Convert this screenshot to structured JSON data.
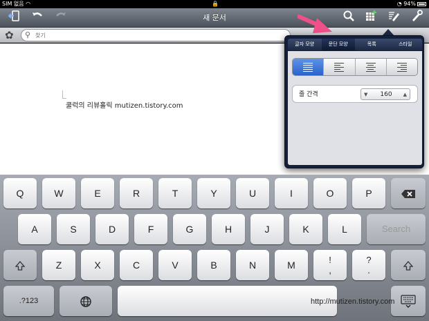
{
  "status_bar": {
    "carrier": "SIM 없음",
    "battery": "94%"
  },
  "toolbar": {
    "title": "새 문서"
  },
  "search": {
    "placeholder": "찾기"
  },
  "document": {
    "text": "쿨럭의 리뷰홀릭 mutizen.tistory.com"
  },
  "popover": {
    "tabs": [
      "글자 모양",
      "문단 모양",
      "목록",
      "스타일"
    ],
    "active_tab": "문단 모양",
    "alignment_options": [
      "justify",
      "left",
      "center",
      "right"
    ],
    "active_alignment": "justify",
    "line_spacing_label": "줄 간격",
    "line_spacing_value": "160"
  },
  "keyboard": {
    "row1": [
      "Q",
      "W",
      "E",
      "R",
      "T",
      "Y",
      "U",
      "I",
      "O",
      "P"
    ],
    "row2": [
      "A",
      "S",
      "D",
      "F",
      "G",
      "H",
      "J",
      "K",
      "L"
    ],
    "row3": [
      "Z",
      "X",
      "C",
      "V",
      "B",
      "N",
      "M"
    ],
    "punct1": "!\n,",
    "punct2": "?\n.",
    "search_key": "Search",
    "numbers_key": ".?123",
    "watermark": "http://mutizen.tistory.com"
  },
  "colors": {
    "accent_blue": "#2a62cc",
    "arrow_pink": "#f0508a"
  }
}
